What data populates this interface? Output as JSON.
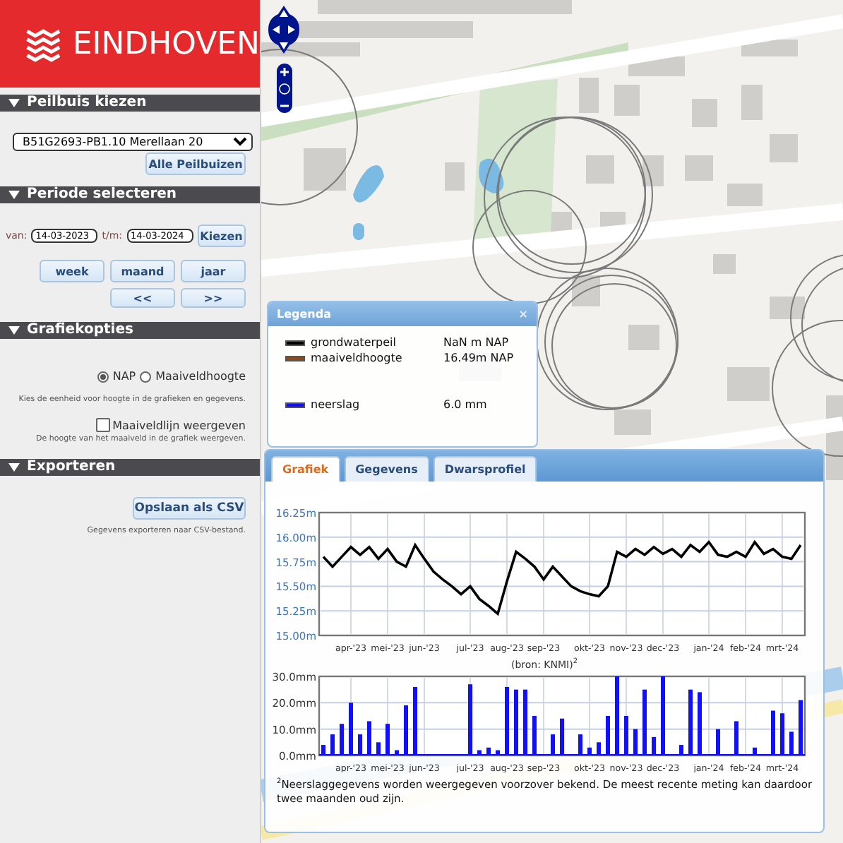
{
  "logo": {
    "text": "EINDHOVEN"
  },
  "well_section": {
    "title": "Peilbuis kiezen",
    "select_value": "B51G2693-PB1.10 Merellaan 20",
    "button": "Alle Peilbuizen"
  },
  "period_section": {
    "title": "Periode selecteren",
    "from_label": "van:",
    "from_value": "14-03-2023",
    "to_label": "t/m:",
    "to_value": "14-03-2024",
    "apply_button": "Kiezen",
    "range_buttons": [
      "week",
      "maand",
      "jaar"
    ],
    "step_buttons": [
      "<<",
      ">>"
    ]
  },
  "graph_options": {
    "title": "Grafiekopties",
    "units": [
      {
        "label": "NAP",
        "selected": true
      },
      {
        "label": "Maaiveldhoogte",
        "selected": false
      }
    ],
    "units_hint": "Kies de eenheid voor hoogte in de grafieken en gegevens.",
    "ground_line": {
      "label": "Maaiveldlijn weergeven",
      "checked": false
    },
    "ground_hint": "De hoogte van het maaiveld in de grafiek weergeven."
  },
  "export_section": {
    "title": "Exporteren",
    "button": "Opslaan als CSV",
    "hint": "Gegevens exporteren naar CSV-bestand."
  },
  "legend": {
    "title": "Legenda",
    "close": "×",
    "items": [
      {
        "name": "grondwaterpeil",
        "value": "NaN m NAP",
        "color": "#000000"
      },
      {
        "name": "maaiveldhoogte",
        "value": "16.49m NAP",
        "color": "#8b4a1c"
      },
      {
        "name": "neerslag",
        "value": "6.0 mm",
        "color": "#1010ff"
      }
    ]
  },
  "tabs": [
    {
      "label": "Grafiek",
      "selected": true
    },
    {
      "label": "Gegevens",
      "selected": false
    },
    {
      "label": "Dwarsprofiel",
      "selected": false
    }
  ],
  "groundwater_chart": {
    "chart_data": {
      "type": "line",
      "grid": true,
      "ylim": [
        15,
        16.25
      ],
      "yticks": [
        {
          "value": 15,
          "label": "15.00m"
        },
        {
          "value": 15.25,
          "label": "15.25m"
        },
        {
          "value": 15.5,
          "label": "15.50m"
        },
        {
          "value": 15.75,
          "label": "15.75m"
        },
        {
          "value": 16,
          "label": "16.00m"
        },
        {
          "value": 16.25,
          "label": "16.25m"
        }
      ],
      "categories": [
        null,
        null,
        null,
        "apr-'23",
        null,
        null,
        null,
        "mei-'23",
        null,
        null,
        null,
        "jun-'23",
        null,
        null,
        null,
        null,
        "jul-'23",
        null,
        null,
        null,
        "aug-'23",
        null,
        null,
        null,
        "sep-'23",
        null,
        null,
        null,
        null,
        "okt-'23",
        null,
        null,
        null,
        "nov-'23",
        null,
        null,
        null,
        "dec-'23",
        null,
        null,
        null,
        null,
        "jan-'24",
        null,
        null,
        null,
        "feb-'24",
        null,
        null,
        null,
        "mrt-'24",
        null,
        null
      ],
      "series": [
        {
          "color": "#000000",
          "values": [
            15.8,
            15.7,
            15.8,
            15.9,
            15.82,
            15.9,
            15.78,
            15.88,
            15.75,
            15.7,
            15.92,
            15.78,
            15.65,
            15.57,
            15.5,
            15.42,
            15.5,
            15.37,
            15.3,
            15.22,
            15.55,
            15.85,
            15.78,
            15.7,
            15.57,
            15.7,
            15.6,
            15.5,
            15.45,
            15.42,
            15.4,
            15.5,
            15.85,
            15.8,
            15.88,
            15.82,
            15.9,
            15.83,
            15.88,
            15.8,
            15.92,
            15.85,
            15.95,
            15.82,
            15.8,
            15.85,
            15.8,
            15.95,
            15.83,
            15.88,
            15.8,
            15.78,
            15.92
          ]
        }
      ]
    }
  },
  "precipitation_chart": {
    "source_note": "(bron: KNMI)$^{2}$",
    "chart_data": {
      "type": "bar",
      "grid": true,
      "ylim": [
        0,
        30
      ],
      "yticks": [
        {
          "value": 0,
          "label": "0.0mm"
        },
        {
          "value": 10,
          "label": "10.0mm"
        },
        {
          "value": 20,
          "label": "20.0mm"
        },
        {
          "value": 30,
          "label": "30.0mm"
        }
      ],
      "categories": [
        null,
        null,
        null,
        "apr-'23",
        null,
        null,
        null,
        "mei-'23",
        null,
        null,
        null,
        "jun-'23",
        null,
        null,
        null,
        null,
        "jul-'23",
        null,
        null,
        null,
        "aug-'23",
        null,
        null,
        null,
        "sep-'23",
        null,
        null,
        null,
        null,
        "okt-'23",
        null,
        null,
        null,
        "nov-'23",
        null,
        null,
        null,
        "dec-'23",
        null,
        null,
        null,
        null,
        "jan-'24",
        null,
        null,
        null,
        "feb-'24",
        null,
        null,
        null,
        "mrt-'24",
        null,
        null
      ],
      "series": [
        {
          "color": "#1010ff",
          "values": [
            4,
            8,
            12,
            20,
            8,
            13,
            5,
            12,
            2,
            19,
            26,
            0,
            0,
            0,
            0,
            0,
            27,
            2,
            3,
            2,
            26,
            25,
            25,
            15,
            0,
            8,
            14,
            0,
            8,
            3,
            5,
            15,
            30,
            15,
            10,
            25,
            7,
            30,
            0,
            4,
            25,
            24,
            0,
            10,
            0,
            13,
            0,
            3,
            0,
            17,
            16,
            9,
            21
          ]
        }
      ]
    }
  },
  "footnote": "$^{2}$Neerslaggegevens worden weergegeven voorzover bekend. De meest recente meting kan daardoor twee maanden oud zijn."
}
